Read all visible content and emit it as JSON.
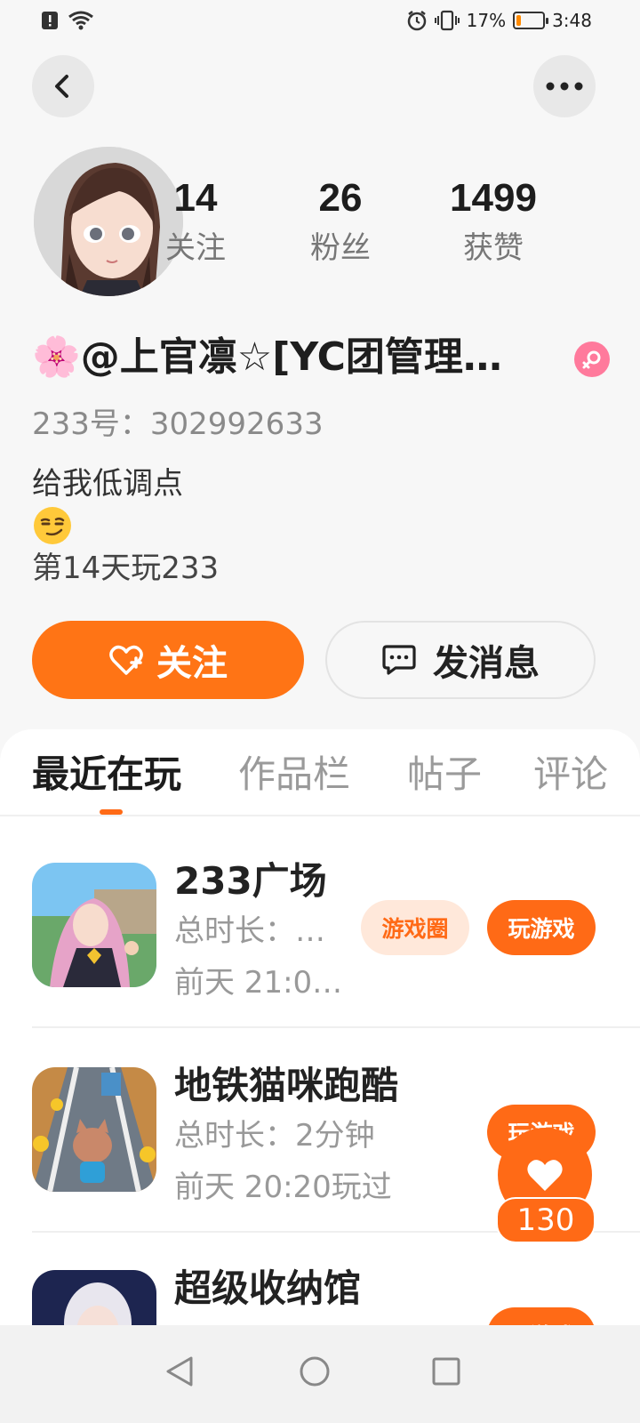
{
  "status_bar": {
    "battery_text": "17%",
    "battery_level": 0.17,
    "time": "3:48"
  },
  "profile": {
    "stats": [
      {
        "value": "14",
        "label": "关注"
      },
      {
        "value": "26",
        "label": "粉丝"
      },
      {
        "value": "1499",
        "label": "获赞"
      }
    ],
    "nickname": "🌸@上官凛☆[YC团管理…",
    "uid": "233号：302992633",
    "bio_line1": "给我低调点",
    "days_played": "第14天玩233",
    "follow_label": "关注",
    "message_label": "发消息"
  },
  "tabs": [
    {
      "label": "最近在玩",
      "active": true
    },
    {
      "label": "作品栏",
      "active": false
    },
    {
      "label": "帖子",
      "active": false
    },
    {
      "label": "评论",
      "active": false
    }
  ],
  "games": [
    {
      "title": "233广场",
      "duration": "总时长：…",
      "last_played": "前天 21:0…",
      "circle_label": "游戏圈",
      "play_label": "玩游戏"
    },
    {
      "title": "地铁猫咪跑酷",
      "duration": "总时长：2分钟",
      "last_played": "前天 20:20玩过",
      "play_label": "玩游戏"
    },
    {
      "title": "超级收纳馆",
      "play_label": "玩游戏"
    }
  ],
  "like_float": {
    "count": "130"
  },
  "colors": {
    "accent": "#ff6a16",
    "follow_button": "#ff7415",
    "gender_badge": "#ff7a9c"
  }
}
